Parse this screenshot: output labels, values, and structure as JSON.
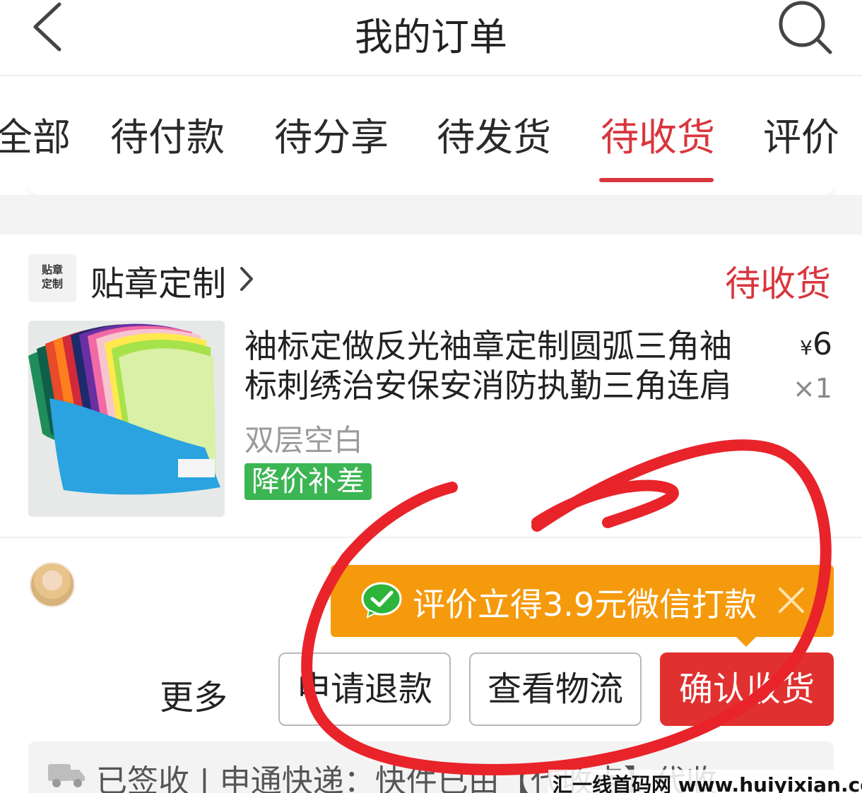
{
  "header": {
    "title": "我的订单",
    "back_icon": "chevron-left-icon",
    "search_icon": "search-icon"
  },
  "tabs": [
    {
      "label": "全部",
      "active": false
    },
    {
      "label": "待付款",
      "active": false
    },
    {
      "label": "待分享",
      "active": false
    },
    {
      "label": "待发货",
      "active": false
    },
    {
      "label": "待收货",
      "active": true
    },
    {
      "label": "评价",
      "active": false
    }
  ],
  "order": {
    "shop": {
      "logo_line1": "贴章",
      "logo_line2": "定制",
      "name": "贴章定制"
    },
    "status": "待收货",
    "product": {
      "title": "袖标定做反光袖章定制圆弧三角袖标刺绣治安保安消防执勤三角连肩",
      "price_symbol": "¥",
      "price": "6",
      "quantity": "×1",
      "variant": "双层空白",
      "promo_tag": "降价补差"
    },
    "review_banner": {
      "text": "评价立得3.9元微信打款",
      "icon": "wechat-icon"
    },
    "actions": {
      "more": "更多",
      "refund": "申请退款",
      "logistics": "查看物流",
      "confirm": "确认收货"
    },
    "tracking": {
      "text": "已签收 | 申通快递：快件已由【代收点】代收"
    }
  },
  "watermark": "汇一线首码网 www.huiyixian.com",
  "colors": {
    "accent_red": "#d9363e",
    "confirm_red": "#e0302f",
    "banner_orange": "#f59a0c",
    "promo_green": "#3cb553",
    "annotation_red": "#e8242a"
  }
}
